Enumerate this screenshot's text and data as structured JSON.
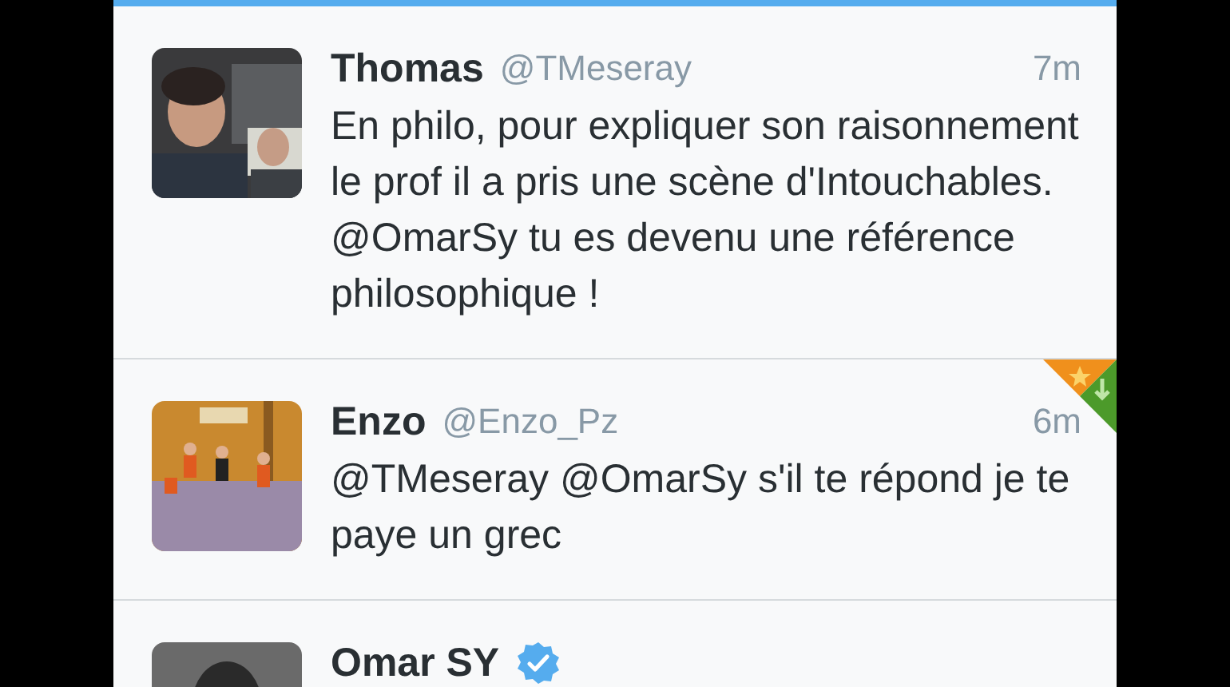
{
  "tweets": [
    {
      "name": "Thomas",
      "handle": "@TMeseray",
      "time": "7m",
      "text": "En philo, pour expliquer son raisonnement le prof il a pris une scène d'Intouchables. @OmarSy tu es devenu une référence philosophique !",
      "verified": false,
      "favorited": false,
      "retweeted": false
    },
    {
      "name": "Enzo",
      "handle": "@Enzo_Pz",
      "time": "6m",
      "text": "@TMeseray @OmarSy s'il te répond je te paye un grec",
      "verified": false,
      "favorited": true,
      "retweeted": true
    },
    {
      "name": "Omar SY",
      "verified": true,
      "favorited": false,
      "retweeted": false
    }
  ]
}
